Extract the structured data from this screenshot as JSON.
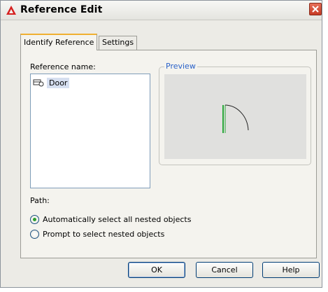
{
  "window": {
    "title": "Reference Edit",
    "icon": "autocad-logo-icon"
  },
  "tabs": [
    {
      "label": "Identify Reference",
      "active": true
    },
    {
      "label": "Settings",
      "active": false
    }
  ],
  "reference": {
    "name_label": "Reference name:",
    "items": [
      {
        "label": "Door",
        "icon": "block-reference-icon",
        "selected": true
      }
    ]
  },
  "preview": {
    "label": "Preview"
  },
  "path": {
    "label": "Path:",
    "options": [
      {
        "label": "Automatically select all nested objects",
        "selected": true
      },
      {
        "label": "Prompt to select nested objects",
        "selected": false
      }
    ]
  },
  "buttons": {
    "ok": "OK",
    "cancel": "Cancel",
    "help": "Help"
  },
  "colors": {
    "accent_tab": "#f0b030",
    "legend": "#2a62c9",
    "radio_dot": "#2d9f2d",
    "door_line": "#2aa83a"
  }
}
